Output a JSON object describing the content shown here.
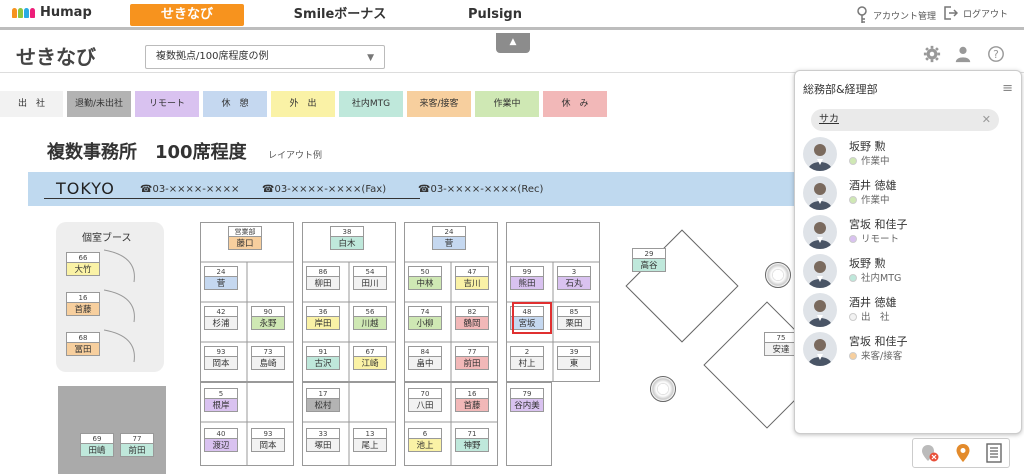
{
  "header": {
    "logo": "Humap",
    "tabs": [
      {
        "label": "せきなび",
        "active": true
      },
      {
        "label": "Smileボーナス",
        "active": false
      },
      {
        "label": "Pulsign",
        "active": false
      }
    ],
    "account_label": "アカウント管理",
    "logout_label": "ログアウト"
  },
  "subheader": {
    "title": "せきなび",
    "layout_select": "複数拠点/100席程度の例",
    "icons": [
      "gear-icon",
      "user-icon",
      "help-icon"
    ]
  },
  "statuses": [
    {
      "label": "出　社",
      "color": "#f2f2f2"
    },
    {
      "label": "退勤/未出社",
      "color": "#b3b3b3"
    },
    {
      "label": "リモート",
      "color": "#d9c2f0"
    },
    {
      "label": "休　憩",
      "color": "#c5d8f0"
    },
    {
      "label": "外　出",
      "color": "#faf2a6"
    },
    {
      "label": "社内MTG",
      "color": "#bfe8db"
    },
    {
      "label": "来客/接客",
      "color": "#f7cf9e"
    },
    {
      "label": "作業中",
      "color": "#cfe8b4"
    },
    {
      "label": "休　み",
      "color": "#f2b8b8"
    }
  ],
  "office": {
    "title": "複数事務所　100席程度",
    "subtitle": "レイアウト例",
    "location": "TOKYO",
    "phones": [
      "☎03-××××-××××",
      "☎03-××××-××××(Fax)",
      "☎03-××××-××××(Rec)"
    ]
  },
  "booth_label": "個室ブース",
  "seats": [
    {
      "num": "66",
      "name": "大竹",
      "color": "#faf2a6"
    },
    {
      "num": "16",
      "name": "首藤",
      "color": "#f7cf9e"
    },
    {
      "num": "68",
      "name": "冨田",
      "color": "#f7cf9e"
    },
    {
      "num": "69",
      "name": "田嶋",
      "color": "#bfe8db"
    },
    {
      "num": "77",
      "name": "前田",
      "color": "#bfe8db"
    },
    {
      "num": "営業部",
      "name": "藤口",
      "color": "#f7cf9e"
    },
    {
      "num": "24",
      "name": "菅",
      "color": "#c5d8f0"
    },
    {
      "num": "42",
      "name": "杉浦",
      "color": "#f2f2f2"
    },
    {
      "num": "90",
      "name": "永野",
      "color": "#cfe8b4"
    },
    {
      "num": "93",
      "name": "岡本",
      "color": "#f2f2f2"
    },
    {
      "num": "73",
      "name": "島崎",
      "color": "#f2f2f2"
    },
    {
      "num": "5",
      "name": "根岸",
      "color": "#d9c2f0"
    },
    {
      "num": "40",
      "name": "渡辺",
      "color": "#d9c2f0"
    },
    {
      "num": "93",
      "name": "岡本",
      "color": "#f2f2f2"
    },
    {
      "num": "38",
      "name": "白木",
      "color": "#bfe8db"
    },
    {
      "num": "86",
      "name": "柳田",
      "color": "#f2f2f2"
    },
    {
      "num": "54",
      "name": "田川",
      "color": "#f2f2f2"
    },
    {
      "num": "36",
      "name": "岸田",
      "color": "#faf2a6"
    },
    {
      "num": "56",
      "name": "川越",
      "color": "#cfe8b4"
    },
    {
      "num": "91",
      "name": "古沢",
      "color": "#bfe8db"
    },
    {
      "num": "67",
      "name": "江崎",
      "color": "#faf2a6"
    },
    {
      "num": "17",
      "name": "松村",
      "color": "#b3b3b3"
    },
    {
      "num": "33",
      "name": "塚田",
      "color": "#f2f2f2"
    },
    {
      "num": "13",
      "name": "尾上",
      "color": "#f2f2f2"
    },
    {
      "num": "24",
      "name": "菅",
      "color": "#c5d8f0"
    },
    {
      "num": "50",
      "name": "中林",
      "color": "#cfe8b4"
    },
    {
      "num": "47",
      "name": "吉川",
      "color": "#faf2a6"
    },
    {
      "num": "74",
      "name": "小柳",
      "color": "#cfe8b4"
    },
    {
      "num": "82",
      "name": "鶴岡",
      "color": "#f2b8b8"
    },
    {
      "num": "84",
      "name": "畠中",
      "color": "#f2f2f2"
    },
    {
      "num": "77",
      "name": "前田",
      "color": "#f2b8b8"
    },
    {
      "num": "70",
      "name": "八田",
      "color": "#f2f2f2"
    },
    {
      "num": "16",
      "name": "首藤",
      "color": "#f2b8b8"
    },
    {
      "num": "6",
      "name": "池上",
      "color": "#faf2a6"
    },
    {
      "num": "71",
      "name": "神野",
      "color": "#bfe8db"
    },
    {
      "num": "99",
      "name": "熊田",
      "color": "#d9c2f0"
    },
    {
      "num": "3",
      "name": "石丸",
      "color": "#d9c2f0"
    },
    {
      "num": "48",
      "name": "宮坂",
      "color": "#c5d8f0"
    },
    {
      "num": "85",
      "name": "栗田",
      "color": "#f2f2f2"
    },
    {
      "num": "2",
      "name": "村上",
      "color": "#f2f2f2"
    },
    {
      "num": "39",
      "name": "東",
      "color": "#f2f2f2"
    },
    {
      "num": "79",
      "name": "谷内美",
      "color": "#d9c2f0"
    },
    {
      "num": "29",
      "name": "高谷",
      "color": "#bfe8db"
    },
    {
      "num": "75",
      "name": "安達",
      "color": "#f2f2f2"
    }
  ],
  "panel": {
    "title": "総務部&経理部",
    "search_value": "サカ",
    "people": [
      {
        "name": "坂野 勲",
        "status": "作業中",
        "dot": "#cfe8b4"
      },
      {
        "name": "酒井 徳雄",
        "status": "作業中",
        "dot": "#cfe8b4"
      },
      {
        "name": "宮坂 和佳子",
        "status": "リモート",
        "dot": "#d9c2f0"
      },
      {
        "name": "坂野 勲",
        "status": "社内MTG",
        "dot": "#bfe8db"
      },
      {
        "name": "酒井 徳雄",
        "status": "出　社",
        "dot": "#f2f2f2"
      },
      {
        "name": "宮坂 和佳子",
        "status": "来客/接客",
        "dot": "#f7cf9e"
      }
    ]
  }
}
